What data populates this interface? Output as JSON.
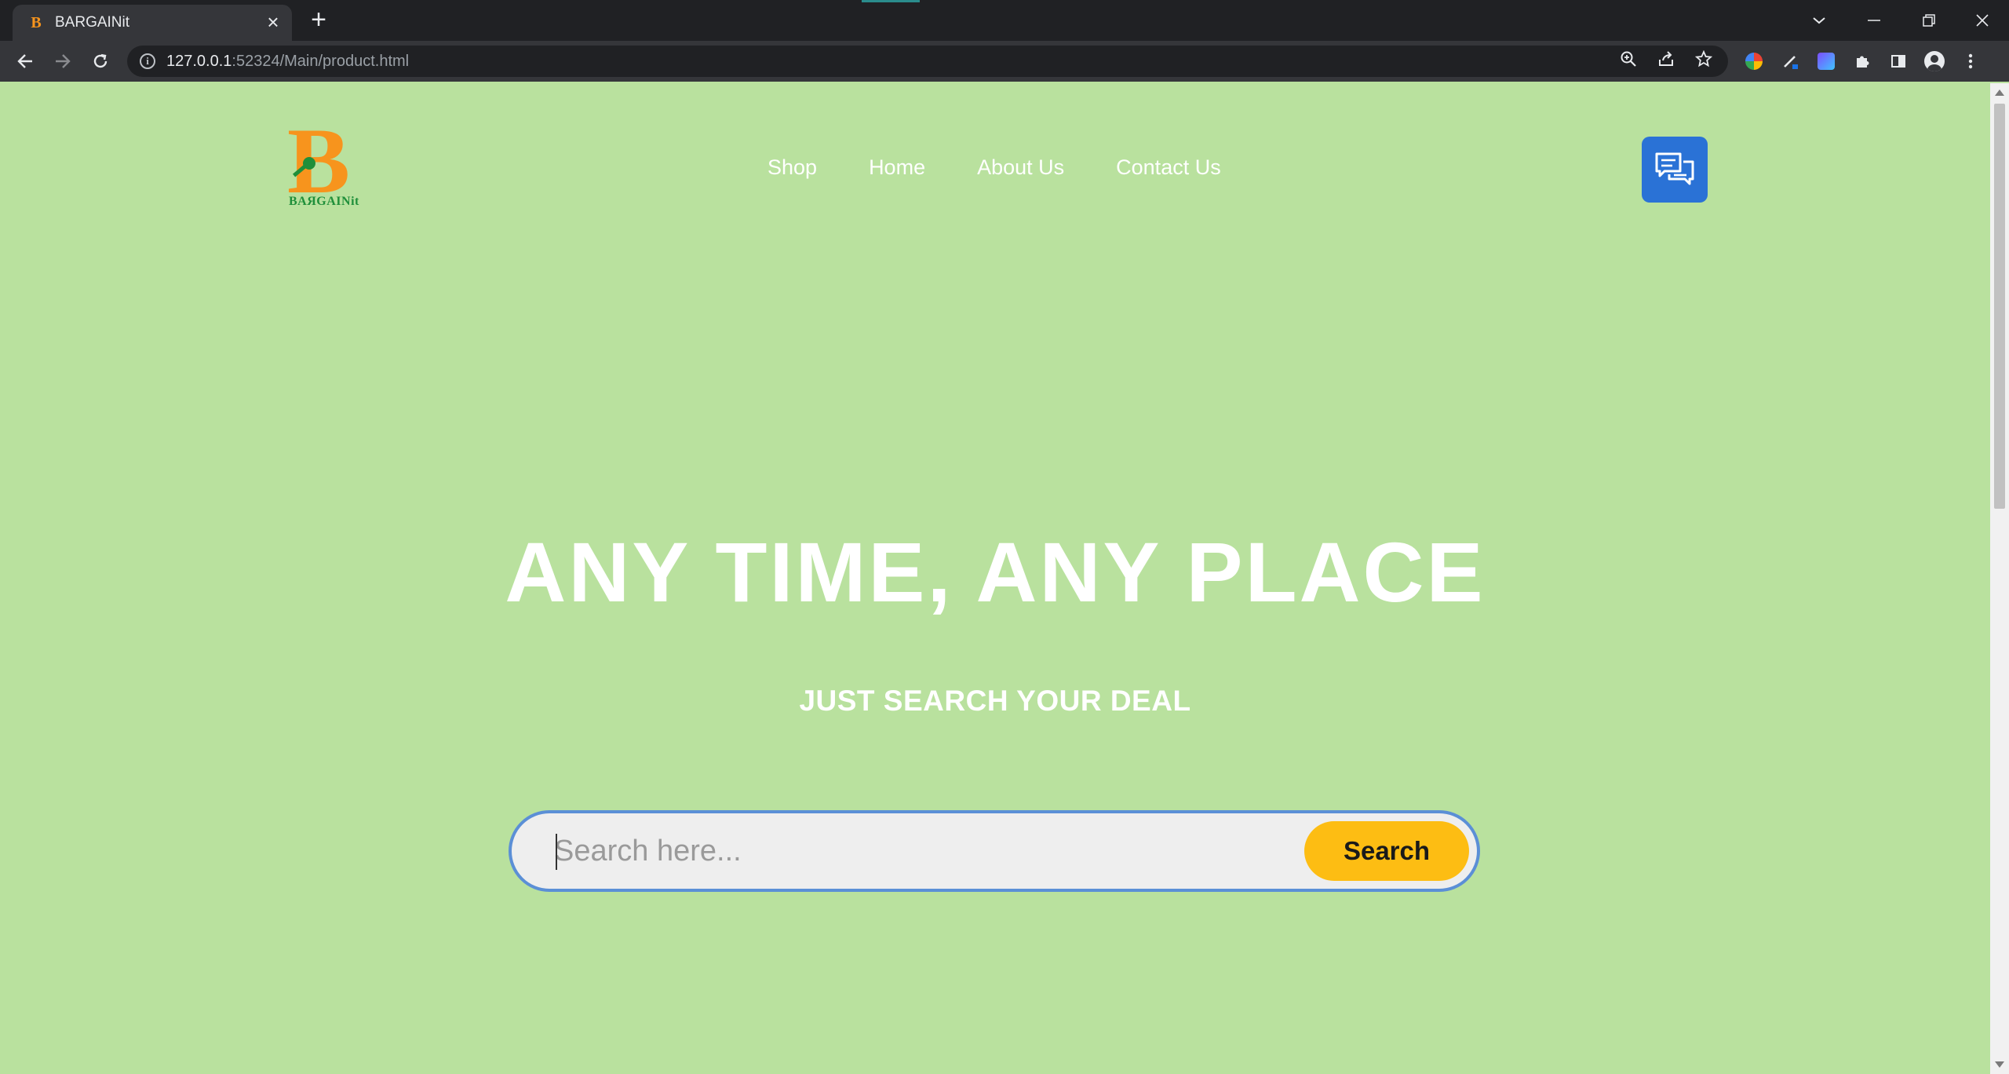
{
  "browser": {
    "tab_title": "BARGAINit",
    "tab_favicon": "B",
    "url_host": "127.0.0.1",
    "url_rest": ":52324/Main/product.html"
  },
  "site": {
    "logo_letter": "B",
    "logo_text": "BAЯGAINit",
    "nav": [
      {
        "label": "Shop"
      },
      {
        "label": "Home"
      },
      {
        "label": "About Us"
      },
      {
        "label": "Contact Us"
      }
    ]
  },
  "hero": {
    "title": "ANY TIME, ANY PLACE",
    "subtitle": "JUST SEARCH YOUR DEAL"
  },
  "search": {
    "placeholder": "Search here...",
    "value": "",
    "button_label": "Search"
  },
  "colors": {
    "page_bg": "#b9e19e",
    "accent_orange": "#f7941d",
    "logo_green": "#1f8f3a",
    "chat_blue": "#2a72d6",
    "search_button": "#fdbd13",
    "search_border": "#5b8fd6"
  }
}
